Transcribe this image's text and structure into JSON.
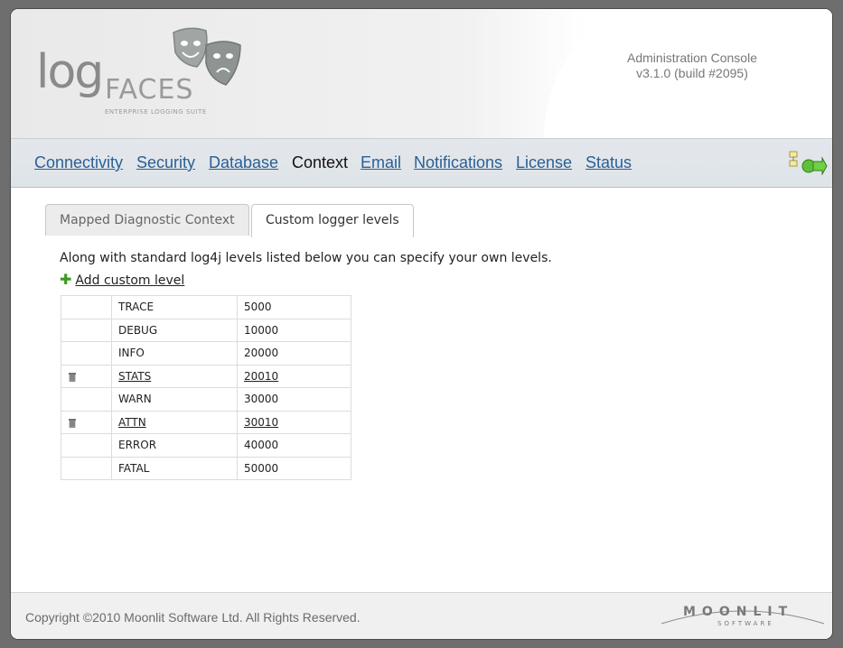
{
  "header": {
    "logo_log": "log",
    "logo_faces": "FACES",
    "logo_tagline": "ENTERPRISE LOGGING SUITE",
    "console_title": "Administration Console",
    "console_version": "v3.1.0 (build #2095)"
  },
  "nav": {
    "items": [
      {
        "label": "Connectivity",
        "active": false
      },
      {
        "label": "Security",
        "active": false
      },
      {
        "label": "Database",
        "active": false
      },
      {
        "label": "Context",
        "active": true
      },
      {
        "label": "Email",
        "active": false
      },
      {
        "label": "Notifications",
        "active": false
      },
      {
        "label": "License",
        "active": false
      },
      {
        "label": "Status",
        "active": false
      }
    ]
  },
  "tabs": [
    {
      "label": "Mapped Diagnostic Context",
      "active": false
    },
    {
      "label": "Custom logger levels",
      "active": true
    }
  ],
  "content": {
    "description": "Along with standard log4j levels listed below you can specify your own levels.",
    "add_label": "Add custom level"
  },
  "levels": [
    {
      "name": "TRACE",
      "value": "5000",
      "custom": false
    },
    {
      "name": "DEBUG",
      "value": "10000",
      "custom": false
    },
    {
      "name": "INFO",
      "value": "20000",
      "custom": false
    },
    {
      "name": "STATS",
      "value": "20010",
      "custom": true
    },
    {
      "name": "WARN",
      "value": "30000",
      "custom": false
    },
    {
      "name": "ATTN",
      "value": "30010",
      "custom": true
    },
    {
      "name": "ERROR",
      "value": "40000",
      "custom": false
    },
    {
      "name": "FATAL",
      "value": "50000",
      "custom": false
    }
  ],
  "footer": {
    "copyright": "Copyright ©2010 Moonlit Software Ltd. All Rights Reserved.",
    "brand": "MOONLIT",
    "brand_sub": "SOFTWARE"
  },
  "colors": {
    "nav_link": "#2b5f94",
    "add_icon": "#3a9b1f"
  }
}
